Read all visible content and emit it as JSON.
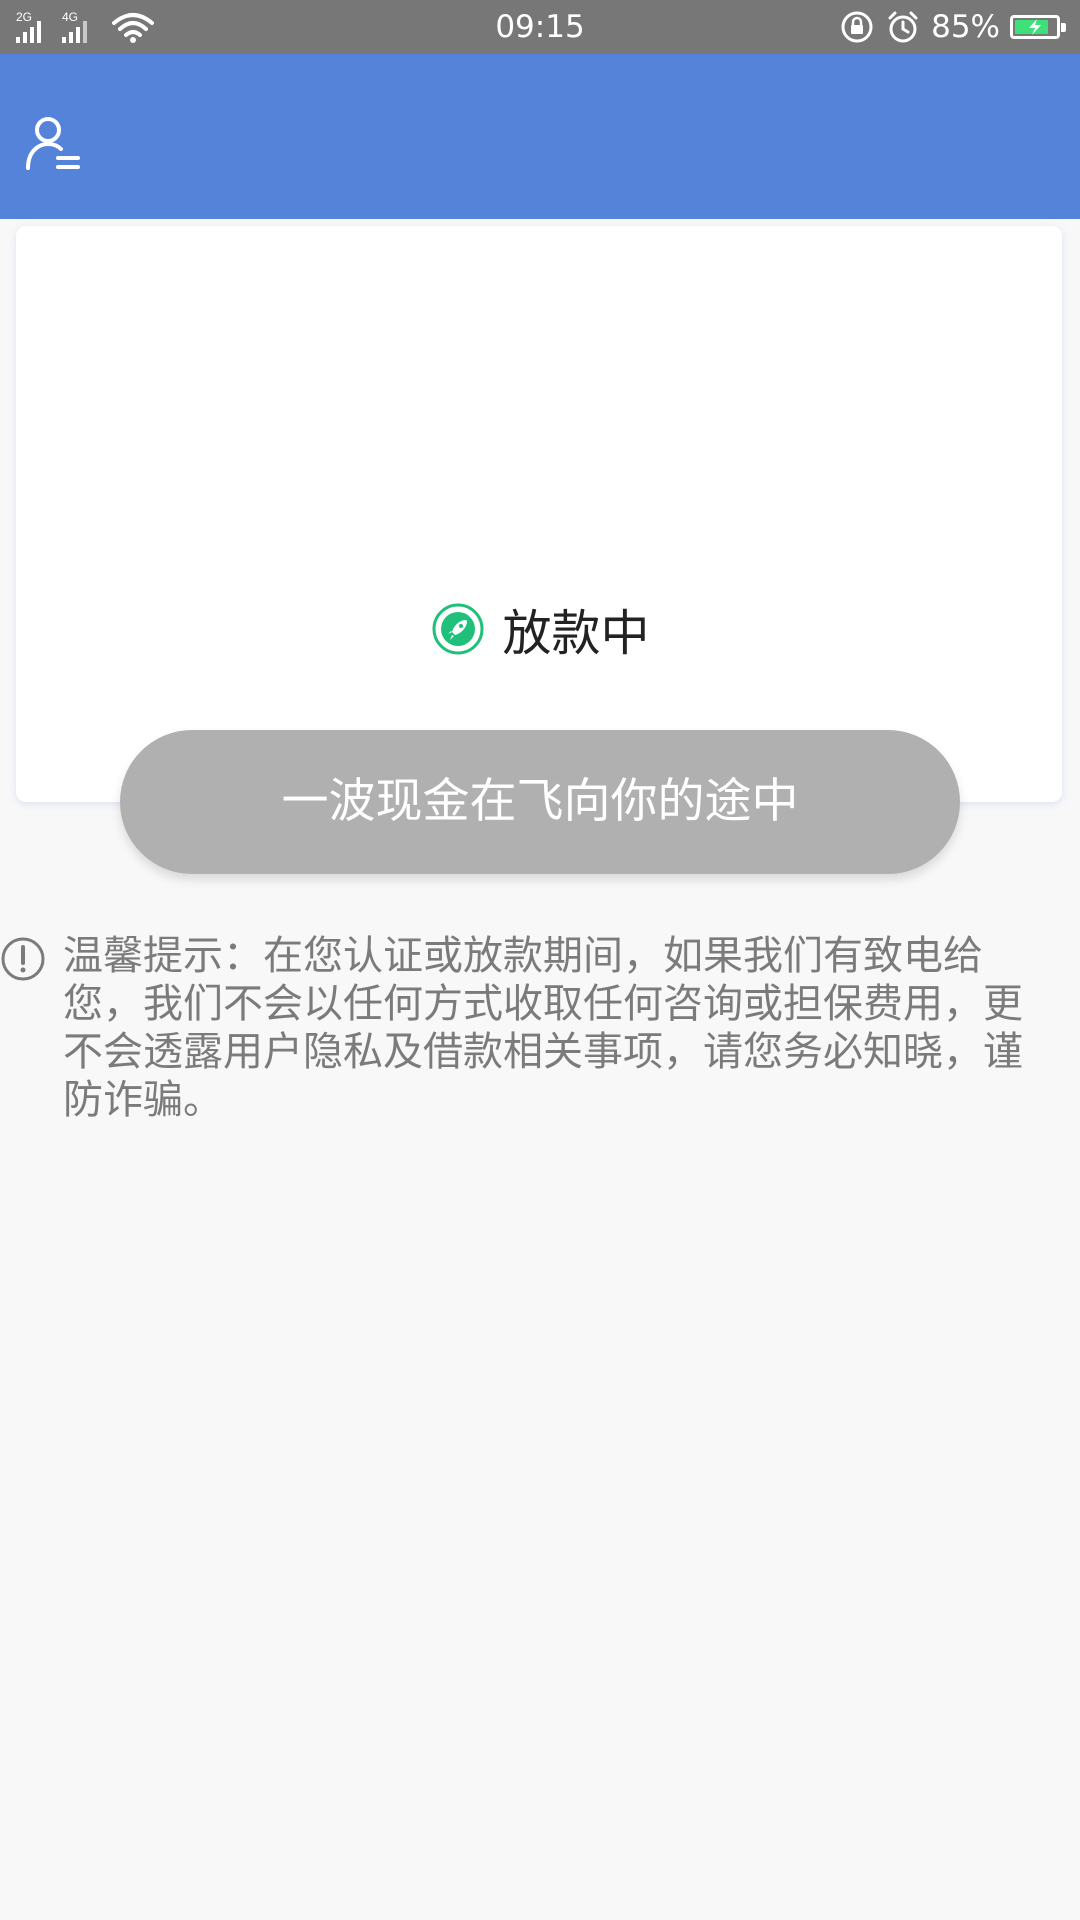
{
  "status_bar": {
    "signal1": "2G",
    "signal2": "4G",
    "time": "09:15",
    "battery_percent": "85%",
    "battery_level": 0.85
  },
  "header": {
    "user_icon": "user-menu-icon"
  },
  "card": {
    "status_icon": "rocket-icon",
    "status_text": "放款中",
    "cta_label": "一波现金在飞向你的途中",
    "accent_color": "#1fc07a"
  },
  "notice": {
    "icon": "alert-circle-icon",
    "text": "温馨提示：在您认证或放款期间，如果我们有致电给您，我们不会以任何方式收取任何咨询或担保费用，更不会透露用户隐私及借款相关事项，请您务必知晓，谨防诈骗。"
  },
  "colors": {
    "app_bar": "#5683da",
    "status_bar": "#777777",
    "button_disabled": "#b0b0b0"
  }
}
